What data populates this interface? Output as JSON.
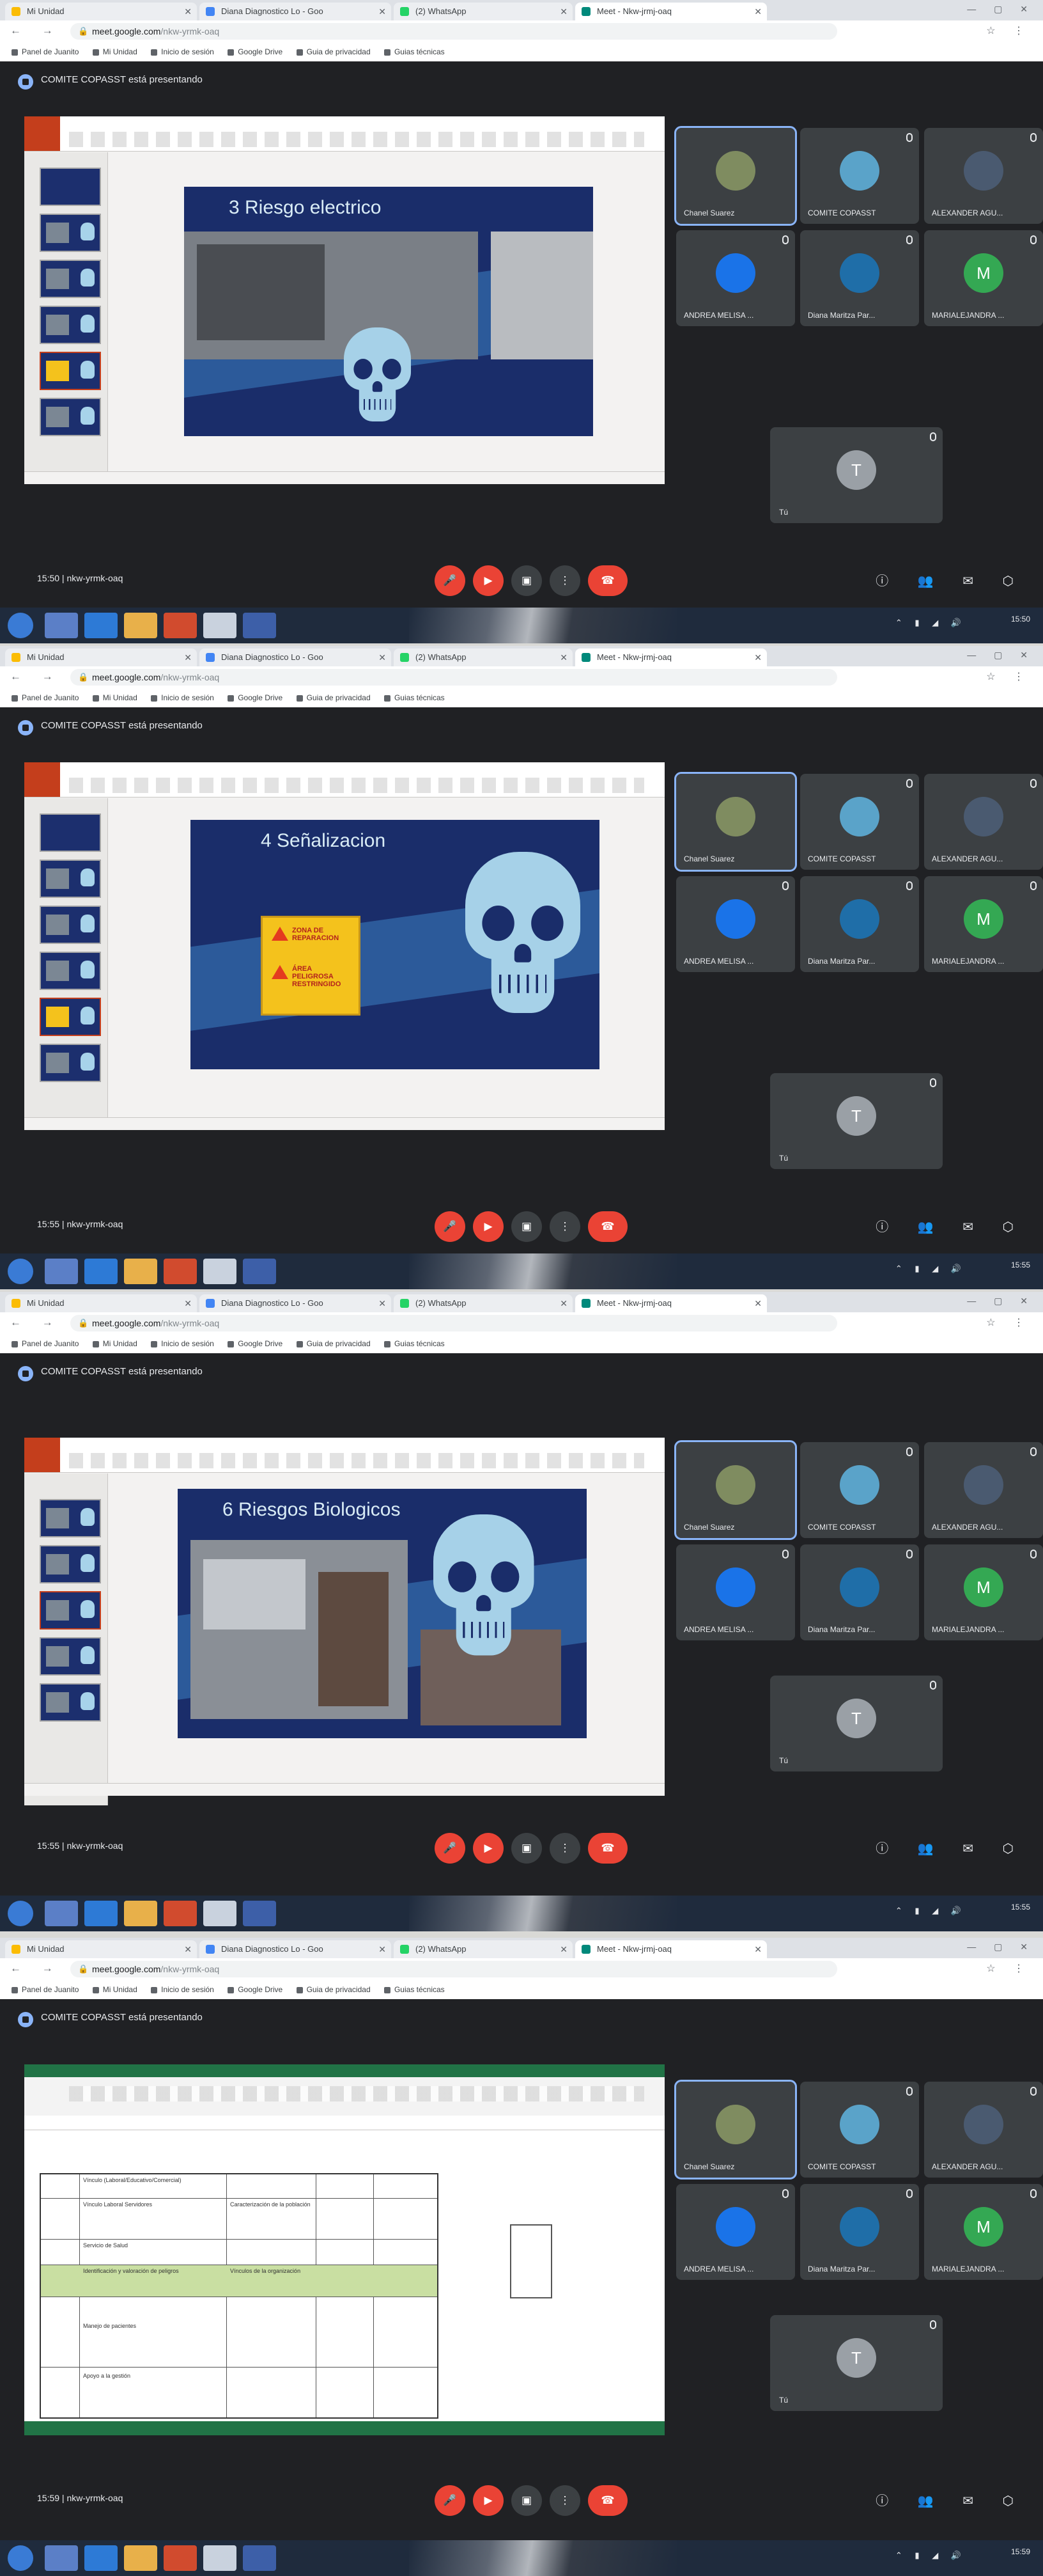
{
  "browser": {
    "tabs": [
      "Mi Unidad",
      "Diana Diagnostico Lo - Goo",
      "(2) WhatsApp",
      "Meet - Nkw-jrmj-oaq"
    ],
    "url_host": "meet.google.com",
    "url_path": "/nkw-yrmk-oaq",
    "bookmarks": [
      "Panel de Juanito",
      "Mi Unidad",
      "Inicio de sesión",
      "Google Drive",
      "Guia de privacidad",
      "Guias técnicas"
    ]
  },
  "meeting": {
    "presenter_banner": "COMITE COPASST está presentando",
    "meeting_code": "nkw-yrmk-oaq",
    "times": [
      "15:50",
      "15:55",
      "15:55",
      "15:59"
    ]
  },
  "participants": [
    {
      "name": "Chanel Suarez",
      "initial": "",
      "color": "#7f8c60"
    },
    {
      "name": "COMITE COPASST",
      "initial": "",
      "color": "#5aa3c9"
    },
    {
      "name": "ALEXANDER AGU...",
      "initial": "",
      "color": "#4a5a70"
    },
    {
      "name": "ANDREA MELISA ...",
      "initial": "",
      "color": "#1a73e8"
    },
    {
      "name": "Diana Maritza Par...",
      "initial": "",
      "color": "#1f6ea8"
    },
    {
      "name": "MARIALEJANDRA ...",
      "initial": "M",
      "color": "#34a853"
    },
    {
      "name": "Tú",
      "initial": "T",
      "color": "#9aa0a6"
    }
  ],
  "slides": [
    {
      "title": "3 Riesgo electrico"
    },
    {
      "title": "4 Señalizacion",
      "sign_lines": [
        "ZONA DE",
        "REPARACION",
        "ÁREA",
        "PELIGROSA",
        "RESTRINGIDO"
      ]
    },
    {
      "title": "6 Riesgos Biologicos"
    }
  ],
  "spreadsheet": {
    "cells": [
      "Vínculo (Laboral/Educativo/Comercial)",
      "Vínculo Laboral Servidores",
      "Caracterización de la población",
      "Servicio de Salud",
      "Identificación y valoración de peligros",
      "Vínculos de la organización",
      "Manejo de pacientes",
      "Apoyo a la gestión"
    ]
  },
  "colors": {
    "accent": "#8ab4f8",
    "end_call": "#ea4335",
    "slide_bg": "#1a2d6a",
    "skull": "#a6d1e8",
    "excel_green": "#217346",
    "ppt_red": "#c43e1c"
  },
  "icons": [
    "mic-off-icon",
    "camera-off-icon",
    "present-icon",
    "more-icon",
    "end-call-icon",
    "info-icon",
    "people-icon",
    "chat-icon",
    "activities-icon"
  ]
}
